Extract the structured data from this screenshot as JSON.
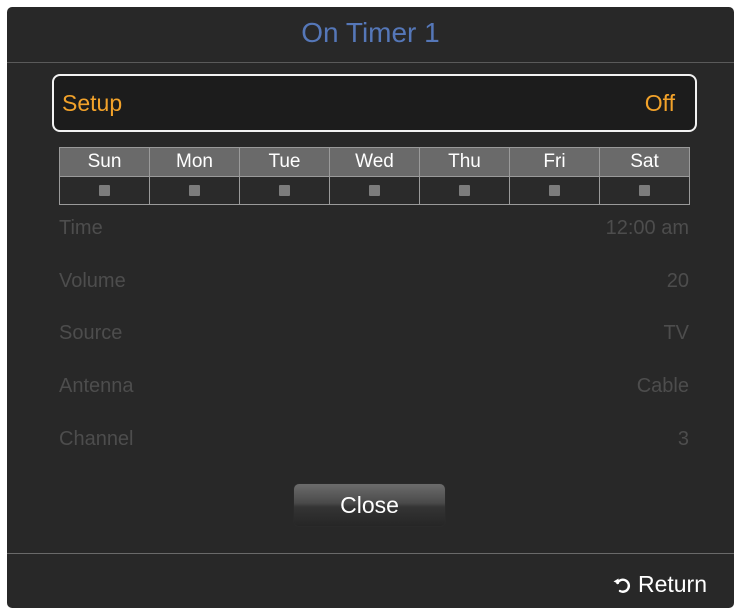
{
  "dialog": {
    "title": "On Timer 1"
  },
  "setup": {
    "label": "Setup",
    "value": "Off"
  },
  "days": [
    "Sun",
    "Mon",
    "Tue",
    "Wed",
    "Thu",
    "Fri",
    "Sat"
  ],
  "settings": {
    "time": {
      "label": "Time",
      "value": "12:00 am"
    },
    "volume": {
      "label": "Volume",
      "value": "20"
    },
    "source": {
      "label": "Source",
      "value": "TV"
    },
    "antenna": {
      "label": "Antenna",
      "value": "Cable"
    },
    "channel": {
      "label": "Channel",
      "value": "3"
    }
  },
  "buttons": {
    "close": "Close"
  },
  "footer": {
    "return_label": "Return",
    "return_icon": "return-arrow-icon"
  },
  "colors": {
    "title": "#5577b8",
    "highlight": "#f2a22a",
    "disabled_text": "#4d4d4d"
  }
}
